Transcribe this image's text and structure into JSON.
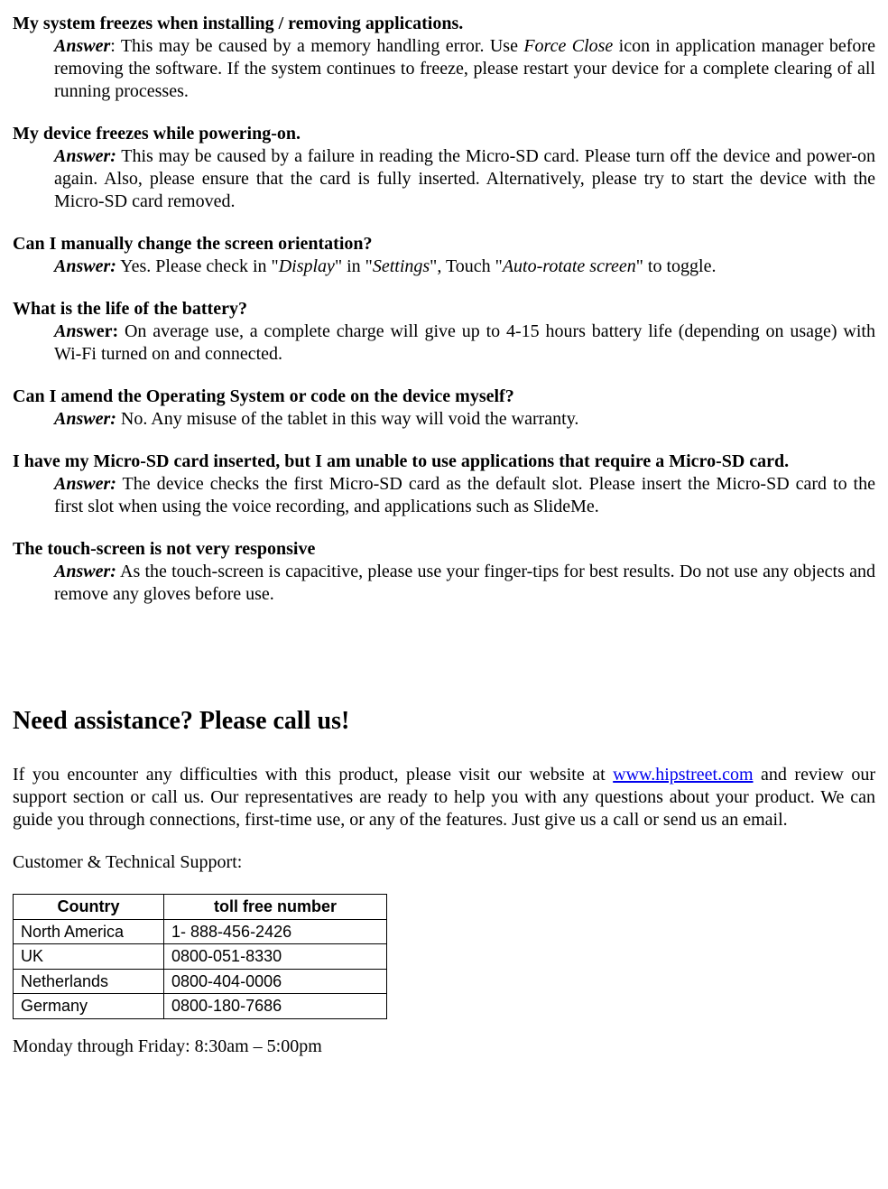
{
  "faq": [
    {
      "question": "My system freezes when installing / removing applications.",
      "answerLabel": "Answer",
      "answerLabelStyle": "partial-italic",
      "answerPrefix": ": This may be caused by a memory handling error.   Use ",
      "answerItalic": "Force Close",
      "answerSuffix": " icon in application manager before removing the software.   If the system continues to freeze, please restart your device for a complete clearing of all running processes."
    },
    {
      "question": "My device freezes while powering-on.",
      "answerLabel": "Answer:",
      "answerLabelStyle": "italic",
      "answerText": " This may be caused by a failure in reading the Micro-SD card.   Please turn off the device and power-on again. Also, please ensure that the card is fully inserted.   Alternatively, please try to start the device with the Micro-SD card removed."
    },
    {
      "question": "Can I manually change the screen orientation?",
      "answerLabel": "Answer:",
      "answerLabelStyle": "italic",
      "parts": [
        {
          "t": " Yes. Please check in \""
        },
        {
          "t": "Display",
          "i": true
        },
        {
          "t": "\" in \""
        },
        {
          "t": "Settings",
          "i": true
        },
        {
          "t": "\", Touch \""
        },
        {
          "t": "Auto-rotate screen",
          "i": true
        },
        {
          "t": "\" to toggle."
        }
      ]
    },
    {
      "question": "What is the life of the battery?",
      "answerLabel": "Answer:",
      "answerLabelStyle": "mixed",
      "answerText": " On average use, a complete charge will give up to 4-15 hours battery life (depending on usage) with Wi-Fi turned on and connected."
    },
    {
      "question": "Can I amend the Operating System or code on the device myself?",
      "answerLabel": "Answer:",
      "answerLabelStyle": "italic",
      "answerText": " No.   Any misuse of the tablet in this way will void the warranty."
    },
    {
      "question": "I have my Micro-SD card inserted, but I am unable to use applications that require a Micro-SD card.",
      "answerLabel": "Answer:",
      "answerLabelStyle": "italic",
      "answerText": " The device checks the first Micro-SD card as the default slot.   Please insert the Micro-SD card to the first slot when using the voice recording, and applications such as SlideMe."
    },
    {
      "question": "The touch-screen is not very responsive",
      "answerLabel": "Answer:",
      "answerLabelStyle": "italic",
      "answerText": " As the touch-screen is capacitive, please use your finger-tips for best results. Do not use any objects and remove any gloves before use."
    }
  ],
  "assist": {
    "heading": "Need assistance? Please call us!",
    "paraPrefix": "If you encounter any difficulties with this product, please visit our website at ",
    "link": "www.hipstreet.com",
    "paraSuffix": " and review our support section or call us. Our representatives are ready to help you with any questions about your product. We can guide you through connections, first-time use, or any of the features. Just give us a call or send us an email.",
    "supportLabel": "Customer & Technical Support:",
    "table": {
      "headers": {
        "country": "Country",
        "number": "toll free number"
      },
      "rows": [
        {
          "country": "North America",
          "number": "1- 888-456-2426"
        },
        {
          "country": "UK",
          "number": "0800-051-8330"
        },
        {
          "country": "Netherlands",
          "number": "0800-404-0006"
        },
        {
          "country": "Germany",
          "number": "0800-180-7686"
        }
      ]
    },
    "hours": "Monday through Friday: 8:30am – 5:00pm"
  }
}
